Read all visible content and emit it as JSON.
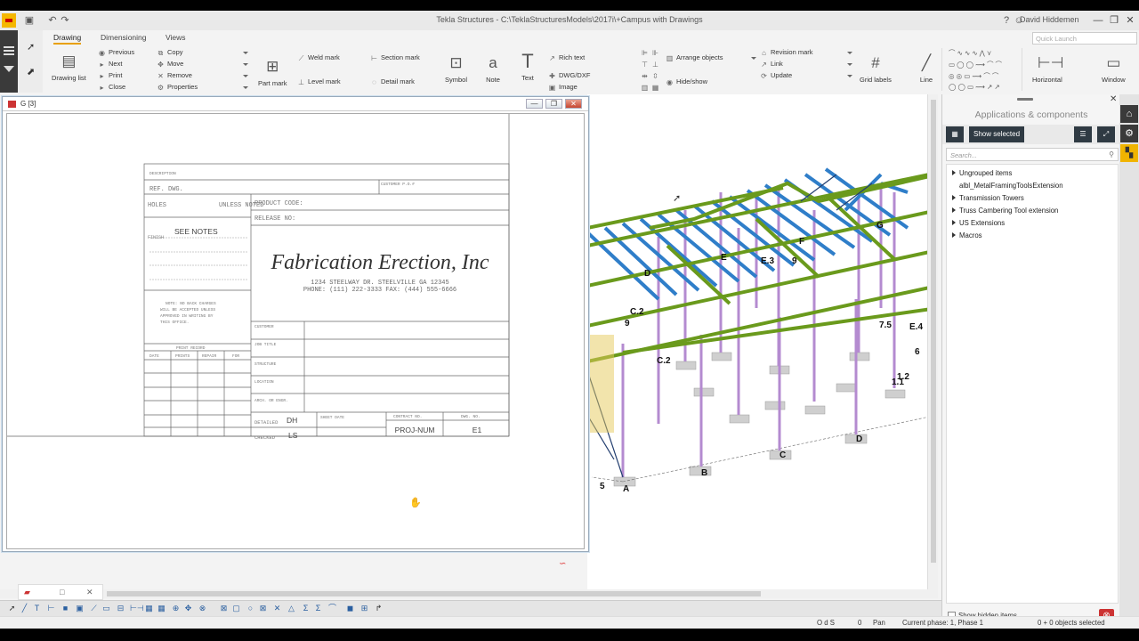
{
  "window": {
    "title": "Tekla Structures - C:\\TeklaStructuresModels\\2017i\\+Campus with Drawings",
    "user": "David Hiddemen",
    "help": "?",
    "minimize": "—",
    "restore": "❐",
    "close": "✕"
  },
  "ribbon": {
    "tabs": [
      "Drawing",
      "Dimensioning",
      "Views"
    ],
    "quick_launch_placeholder": "Quick Launch",
    "drawing_list": "Drawing list",
    "nav": [
      "Previous",
      "Next",
      "Print",
      "Close"
    ],
    "edit": [
      "Copy",
      "Move",
      "Remove",
      "Properties"
    ],
    "part_mark": "Part mark",
    "weld_mark": "Weld mark",
    "level_mark": "Level mark",
    "section_mark": "Section mark",
    "detail_mark": "Detail mark",
    "symbol": "Symbol",
    "note": "Note",
    "text": "Text",
    "rich_text": "Rich text",
    "dwg_dxf": "DWG/DXF",
    "image": "Image",
    "arrange_objects": "Arrange objects",
    "hide_show": "Hide/show",
    "revision": [
      "Revision mark",
      "Link",
      "Update"
    ],
    "grid_labels": "Grid labels",
    "line": "Line",
    "horizontal": "Horizontal",
    "window_btn": "Window"
  },
  "drawing_window": {
    "title": "G  [3]",
    "btn_min": "—",
    "btn_max": "❐",
    "btn_close": "✕"
  },
  "title_block": {
    "description": "DESCRIPTION",
    "ref_dwg": "REF. DWG.",
    "customer_po": "CUSTOMER P.O.#",
    "holes": "HOLES",
    "unless_noted": "UNLESS NOTED",
    "product_code": "PRODUCT CODE:",
    "release_no": "RELEASE NO:",
    "finish": "FINISH",
    "see_notes": "SEE NOTES",
    "company": "Fabrication Erection, Inc",
    "address": "1234 STEELWAY DR. STEELVILLE GA 12345",
    "phone": "PHONE: (111) 222-3333 FAX: (444) 555-6666",
    "note_text": [
      "NOTE: NO BACK CHARGES",
      "WILL BE ACCEPTED UNLESS",
      "APPROVED IN WRITING BY",
      "THIS OFFICE."
    ],
    "print_record": "PRINT RECORD",
    "print_cols": [
      "DATE",
      "PRINTS",
      "REPAIR",
      "FOR"
    ],
    "customer": "CUSTOMER",
    "job_title": "JOB TITLE",
    "structure": "STRUCTURE",
    "location": "LOCATION",
    "architect_engr": "ARCH. OR ENGR.",
    "detailed": "DETAILED",
    "detailed_by": "DH",
    "checked": "CHECKED",
    "checked_by": "LS",
    "sheet_date": "SHEET DATE",
    "contract_no": "CONTRACT NO.",
    "contract_value": "PROJ-NUM",
    "dwg_no": "DWG. NO.",
    "dwg_value": "E1"
  },
  "model_labels": {
    "grid": [
      "A",
      "B",
      "C",
      "D",
      "D",
      "E",
      "E.3",
      "F",
      "G",
      "9",
      "C.2",
      "9",
      "C.2",
      "7.5",
      "E.4",
      "6",
      "1.2",
      "1.1",
      "5"
    ]
  },
  "colors": {
    "steel_green": "#6a9a1c",
    "steel_blue": "#2f7ec9",
    "column_purple": "#b08ac8",
    "accent_yellow": "#f0b400"
  },
  "panel": {
    "title": "Applications & components",
    "show_selected": "Show selected",
    "search_placeholder": "Search...",
    "items": [
      {
        "label": "Ungrouped items",
        "expandable": true
      },
      {
        "label": "albl_MetalFramingToolsExtension",
        "expandable": false
      },
      {
        "label": "Transmission Towers",
        "expandable": true
      },
      {
        "label": "Truss Cambering Tool extension",
        "expandable": true
      },
      {
        "label": "US Extensions",
        "expandable": true
      },
      {
        "label": "Macros",
        "expandable": true
      }
    ],
    "show_hidden": "Show hidden items"
  },
  "bottom_tabs": {
    "close": "✕"
  },
  "status": {
    "snap": "O d S",
    "value": "0",
    "mode": "Pan",
    "phase": "Current phase: 1, Phase 1",
    "selection": "0 + 0 objects selected"
  }
}
